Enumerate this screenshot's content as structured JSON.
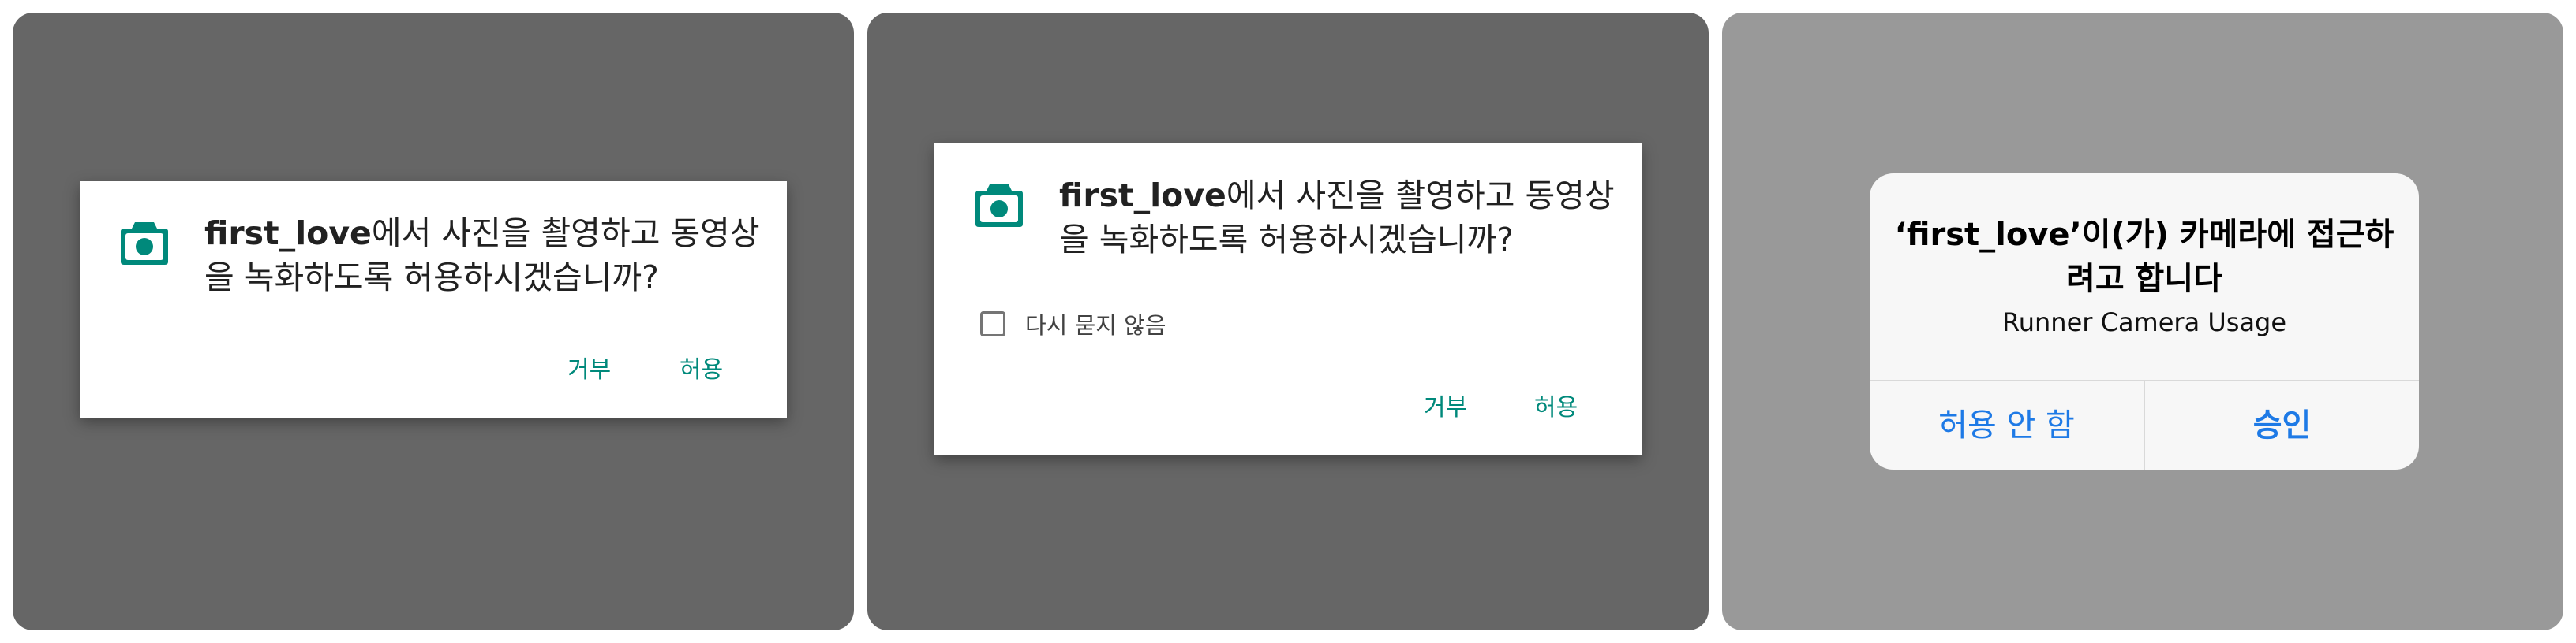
{
  "android_dialog_1": {
    "app_name": "first_love",
    "message_rest": "에서 사진을 촬영하고 동영상을 녹화하도록 허용하시겠습니까?",
    "deny_label": "거부",
    "allow_label": "허용",
    "icon": "camera-icon",
    "accent_color": "#00897b"
  },
  "android_dialog_2": {
    "app_name": "first_love",
    "message_rest": "에서 사진을 촬영하고 동영상을 녹화하도록 허용하시겠습니까?",
    "dont_ask_label": "다시 묻지 않음",
    "dont_ask_checked": false,
    "deny_label": "거부",
    "allow_label": "허용",
    "icon": "camera-icon",
    "accent_color": "#00897b"
  },
  "ios_alert": {
    "title": "‘first_love’이(가) 카메라에 접근하려고 합니다",
    "subtitle": "Runner Camera Usage",
    "deny_label": "허용 안 함",
    "allow_label": "승인",
    "accent_color": "#1e7ae6"
  }
}
